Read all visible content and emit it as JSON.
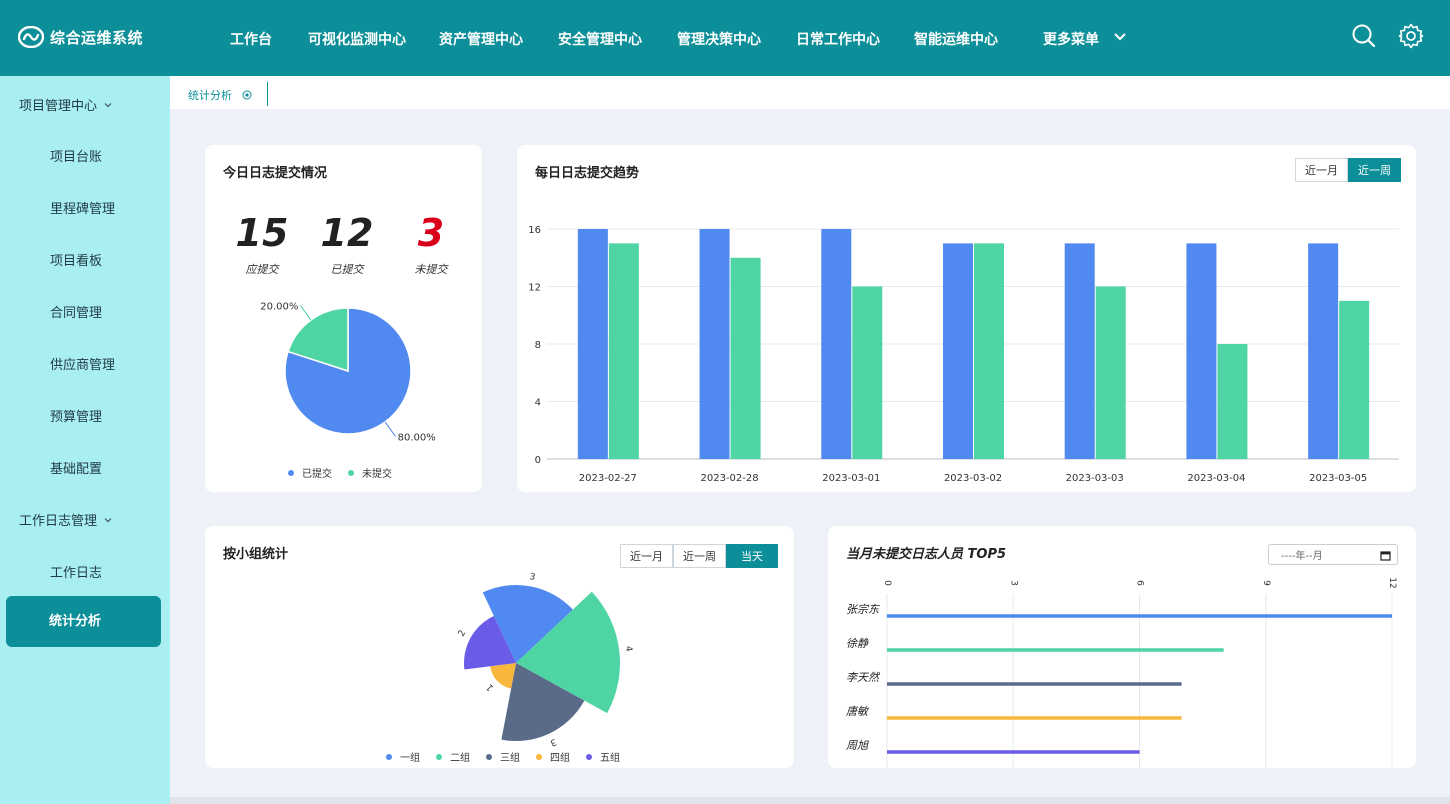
{
  "app": {
    "title": "综合运维系统"
  },
  "nav": {
    "items": [
      "工作台",
      "可视化监测中心",
      "资产管理中心",
      "安全管理中心",
      "管理决策中心",
      "日常工作中心",
      "智能运维中心"
    ],
    "more": "更多菜单"
  },
  "icons": {
    "logo": "logo-icon",
    "search": "search-icon",
    "settings": "gear-icon",
    "chevron": "chevron-down-icon",
    "tab_close": "close-circle-icon",
    "date": "calendar-icon"
  },
  "sidebar": {
    "group1": "项目管理中心",
    "group1_items": [
      "项目台账",
      "里程碑管理",
      "项目看板",
      "合同管理",
      "供应商管理",
      "预算管理",
      "基础配置"
    ],
    "group2": "工作日志管理",
    "group2_items": [
      "工作日志"
    ],
    "active_item": "统计分析"
  },
  "tabs": [
    {
      "label": "统计分析"
    }
  ],
  "colors": {
    "primary": "#0d8f99",
    "sidebar": "#a9eef0",
    "blue": "#5089f0",
    "green": "#4fd5a3",
    "slate": "#5a6b8a",
    "orange": "#f7b73d",
    "purple": "#6a5ce8",
    "danger": "#d9001b"
  },
  "today": {
    "title": "今日日志提交情况",
    "should": {
      "value": "15",
      "label": "应提交"
    },
    "submitted": {
      "value": "12",
      "label": "已提交"
    },
    "missing": {
      "value": "3",
      "label": "未提交"
    }
  },
  "trend": {
    "title": "每日日志提交趋势",
    "range_options": [
      "近一月",
      "近一周"
    ],
    "range_selected": "近一周"
  },
  "group_stats": {
    "title": "按小组统计",
    "range_options": [
      "近一月",
      "近一周",
      "当天"
    ],
    "range_selected": "当天"
  },
  "top5": {
    "title": "当月未提交日志人员 TOP5",
    "date_placeholder": "----年--月"
  },
  "chart_data": [
    {
      "type": "pie",
      "labels": [
        "已提交",
        "未提交"
      ],
      "values": [
        80.0,
        20.0
      ],
      "value_labels": [
        "80.00%",
        "20.00%"
      ],
      "colors": [
        "#5089f0",
        "#4fd5a3"
      ],
      "legend": "bottom"
    },
    {
      "type": "bar",
      "categories": [
        "2023-02-27",
        "2023-02-28",
        "2023-03-01",
        "2023-03-02",
        "2023-03-03",
        "2023-03-04",
        "2023-03-05"
      ],
      "series": [
        {
          "values": [
            16,
            16,
            16,
            15,
            15,
            15,
            15
          ],
          "color": "#5089f0"
        },
        {
          "values": [
            15,
            14,
            12,
            15,
            12,
            8,
            11
          ],
          "color": "#4fd5a3"
        }
      ],
      "yticks": [
        "0",
        "4",
        "8",
        "12",
        "16"
      ],
      "ylim": [
        0,
        16
      ],
      "grid": true
    },
    {
      "type": "rose",
      "labels": [
        "一组",
        "二组",
        "三组",
        "四组",
        "五组"
      ],
      "values": [
        3,
        4,
        3,
        1,
        2
      ],
      "colors": [
        "#5089f0",
        "#4fd5a3",
        "#5a6b8a",
        "#f7b73d",
        "#6a5ce8"
      ],
      "legend": "bottom"
    },
    {
      "type": "bar",
      "orientation": "horizontal",
      "categories": [
        "张宗东",
        "徐静",
        "李天然",
        "唐敏",
        "周旭"
      ],
      "values": [
        12,
        8,
        7,
        7,
        6
      ],
      "colors": [
        "#5089f0",
        "#4fd5a3",
        "#5a6b8a",
        "#f7b73d",
        "#6a5ce8"
      ],
      "xticks": [
        "0",
        "3",
        "6",
        "9",
        "12"
      ],
      "xlim": [
        0,
        12
      ],
      "grid": true
    }
  ]
}
